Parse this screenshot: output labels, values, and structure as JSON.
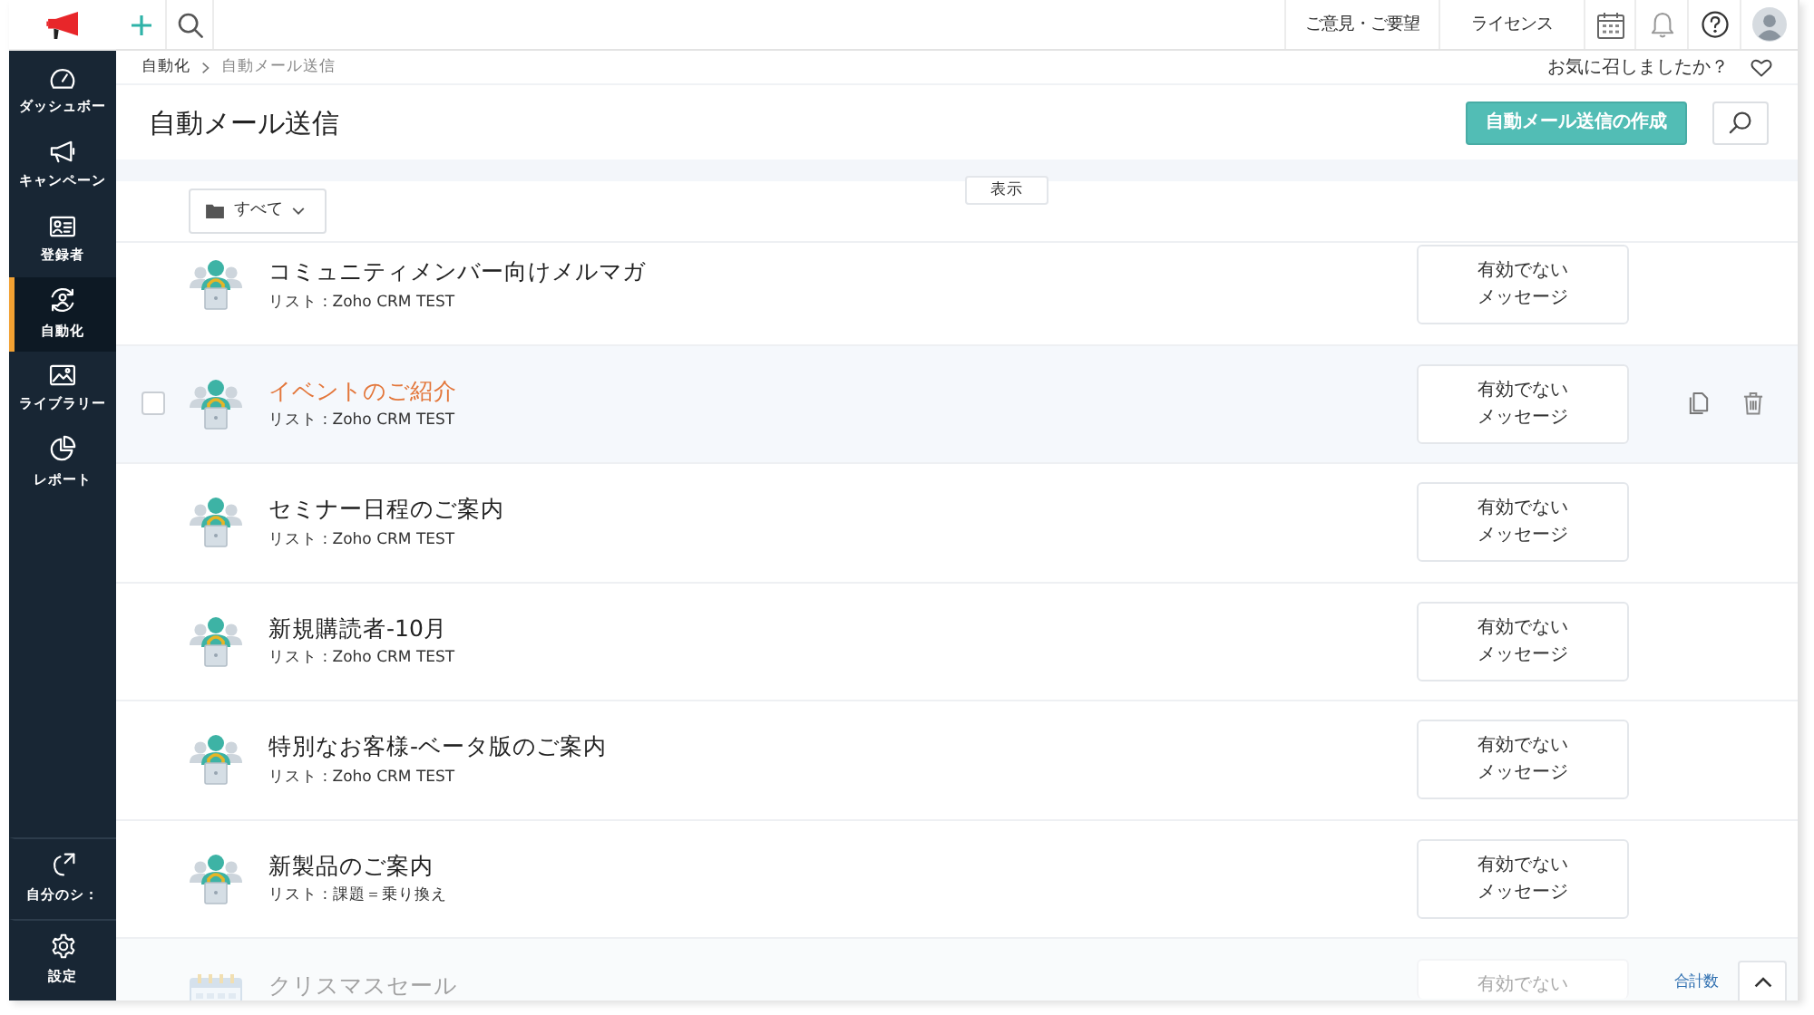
{
  "top_bar": {
    "links": [
      {
        "label": "ご意見・ご要望"
      },
      {
        "label": "ライセンス"
      }
    ]
  },
  "sidebar": {
    "items": [
      {
        "label": "ダッシュボー",
        "selected": false
      },
      {
        "label": "キャンペーン",
        "selected": false
      },
      {
        "label": "登録者",
        "selected": false
      },
      {
        "label": "自動化",
        "selected": true
      },
      {
        "label": "ライブラリー",
        "selected": false
      },
      {
        "label": "レポート",
        "selected": false
      }
    ],
    "bottom_items": [
      {
        "label": "自分のシ："
      },
      {
        "label": "設定"
      }
    ]
  },
  "breadcrumb": {
    "items": [
      {
        "label": "自動化"
      },
      {
        "label": "自動メール送信"
      }
    ],
    "feedback": "お気に召しましたか？"
  },
  "header": {
    "title": "自動メール送信",
    "create_button": "自動メール送信の作成"
  },
  "toolbar": {
    "folder_filter": "すべて",
    "view_tab": "表示"
  },
  "rows": [
    {
      "kind": "list",
      "name": "コミュニティメンバー向けメルマガ",
      "list": "リスト : Zoho CRM TEST",
      "status": "有効でないメッセージ",
      "highlighted": false,
      "dimmed": false
    },
    {
      "kind": "list",
      "name": "イベントのご紹介",
      "list": "リスト : Zoho CRM TEST",
      "status": "有効でないメッセージ",
      "highlighted": true,
      "dimmed": false,
      "checkbox": {
        "checked": false
      }
    },
    {
      "kind": "list",
      "name": "セミナー日程のご案内",
      "list": "リスト : Zoho CRM TEST",
      "status": "有効でないメッセージ",
      "highlighted": false,
      "dimmed": false
    },
    {
      "kind": "list",
      "name": "新規購読者-10月",
      "list": "リスト : Zoho CRM TEST",
      "status": "有効でないメッセージ",
      "highlighted": false,
      "dimmed": false
    },
    {
      "kind": "list",
      "name": "特別なお客様-ベータ版のご案内",
      "list": "リスト : Zoho CRM TEST",
      "status": "有効でないメッセージ",
      "highlighted": false,
      "dimmed": false
    },
    {
      "kind": "list",
      "name": "新製品のご案内",
      "list": "リスト : 課題＝乗り換え",
      "status": "有効でないメッセージ",
      "highlighted": false,
      "dimmed": false
    },
    {
      "kind": "date",
      "name": "クリスマスセール",
      "status": "有効でない",
      "highlighted": false,
      "dimmed": true
    }
  ],
  "footer": {
    "total_label": "合計数"
  }
}
